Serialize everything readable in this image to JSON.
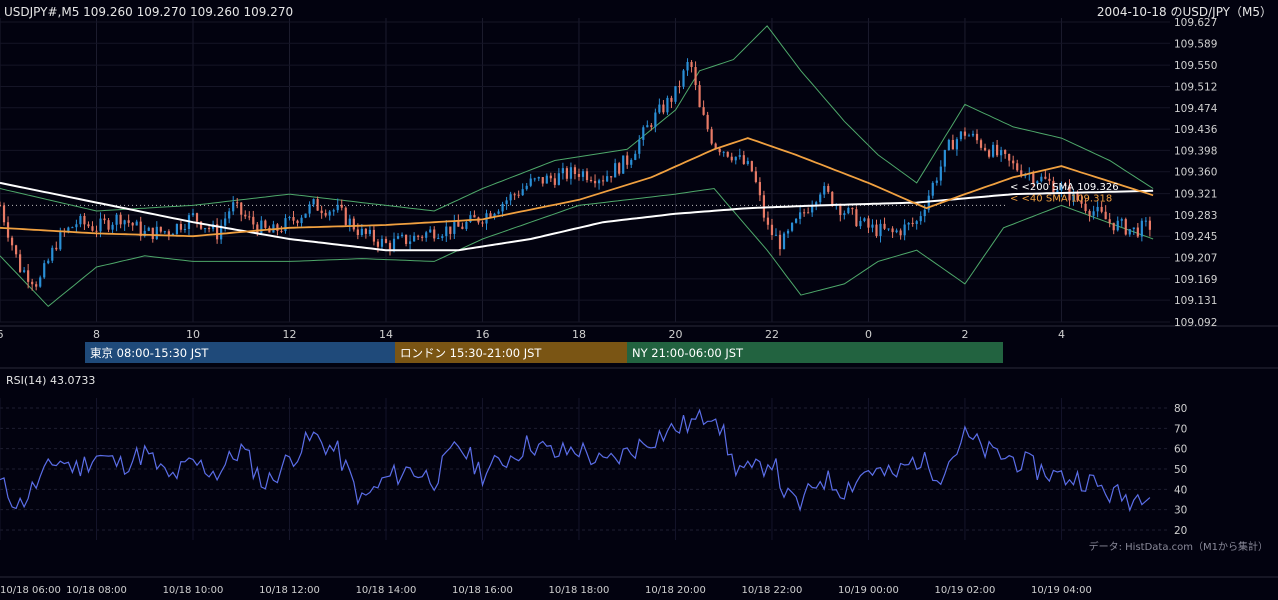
{
  "header": {
    "symbol_line": "USDJPY#,M5 109.260 109.270 109.260 109.270",
    "date_title": "2004-10-18 のUSD/JPY（M5）"
  },
  "sessions": [
    {
      "label": "東京 08:00-15:30 JST",
      "color": "#1f4a7a"
    },
    {
      "label": "ロンドン 15:30-21:00 JST",
      "color": "#7a5514"
    },
    {
      "label": "NY 21:00-06:00 JST",
      "color": "#226340"
    }
  ],
  "rsi_panel": {
    "label": "RSI(14) 43.0733",
    "source_note": "データ: HistData.com（M1から集計）"
  },
  "chart_data": [
    {
      "type": "candlestick",
      "title": "USDJPY#,M5",
      "y_ticks": [
        "109.627",
        "109.589",
        "109.550",
        "109.512",
        "109.474",
        "109.436",
        "109.398",
        "109.360",
        "109.321",
        "109.283",
        "109.245",
        "109.207",
        "109.169",
        "109.131",
        "109.092"
      ],
      "ylim": [
        109.092,
        109.627
      ],
      "x_ticks": [
        "6",
        "8",
        "10",
        "12",
        "14",
        "16",
        "18",
        "20",
        "22",
        "0",
        "2",
        "4"
      ],
      "x_hours_range": [
        6,
        29.9
      ],
      "x_tick_hours": [
        6,
        8,
        10,
        12,
        14,
        16,
        18,
        20,
        22,
        24,
        26,
        28
      ],
      "bottom_time_labels": [
        "10/18 06:00",
        "10/18 08:00",
        "10/18 10:00",
        "10/18 12:00",
        "10/18 14:00",
        "10/18 16:00",
        "10/18 18:00",
        "10/18 20:00",
        "10/18 22:00",
        "10/19 00:00",
        "10/19 02:00",
        "10/19 04:00"
      ],
      "up_color": "#2a8fd6",
      "down_color": "#e87a66",
      "price_path": [
        [
          6.0,
          109.3
        ],
        [
          6.4,
          109.19
        ],
        [
          6.8,
          109.16
        ],
        [
          7.2,
          109.24
        ],
        [
          7.6,
          109.27
        ],
        [
          8.0,
          109.26
        ],
        [
          8.5,
          109.28
        ],
        [
          9.0,
          109.25
        ],
        [
          9.5,
          109.255
        ],
        [
          10.0,
          109.28
        ],
        [
          10.5,
          109.25
        ],
        [
          10.8,
          109.3
        ],
        [
          11.2,
          109.27
        ],
        [
          11.6,
          109.25
        ],
        [
          12.0,
          109.27
        ],
        [
          12.5,
          109.3
        ],
        [
          13.0,
          109.29
        ],
        [
          13.5,
          109.25
        ],
        [
          14.0,
          109.23
        ],
        [
          14.5,
          109.24
        ],
        [
          15.0,
          109.255
        ],
        [
          15.5,
          109.26
        ],
        [
          16.0,
          109.28
        ],
        [
          16.5,
          109.31
        ],
        [
          17.0,
          109.34
        ],
        [
          17.5,
          109.35
        ],
        [
          18.0,
          109.36
        ],
        [
          18.5,
          109.35
        ],
        [
          19.0,
          109.38
        ],
        [
          19.5,
          109.45
        ],
        [
          20.0,
          109.5
        ],
        [
          20.3,
          109.56
        ],
        [
          20.5,
          109.47
        ],
        [
          20.8,
          109.41
        ],
        [
          21.2,
          109.39
        ],
        [
          21.6,
          109.36
        ],
        [
          21.9,
          109.26
        ],
        [
          22.2,
          109.23
        ],
        [
          22.6,
          109.28
        ],
        [
          23.0,
          109.33
        ],
        [
          23.5,
          109.29
        ],
        [
          24.0,
          109.26
        ],
        [
          24.5,
          109.25
        ],
        [
          25.0,
          109.27
        ],
        [
          25.3,
          109.33
        ],
        [
          25.7,
          109.41
        ],
        [
          26.0,
          109.43
        ],
        [
          26.5,
          109.4
        ],
        [
          27.0,
          109.37
        ],
        [
          27.5,
          109.35
        ],
        [
          28.0,
          109.33
        ],
        [
          28.5,
          109.3
        ],
        [
          29.0,
          109.27
        ],
        [
          29.5,
          109.255
        ],
        [
          29.9,
          109.265
        ]
      ],
      "overlays": [
        {
          "name": "<200 SMA 109.326",
          "color": "#ffffff",
          "path": [
            [
              6,
              109.34
            ],
            [
              8,
              109.305
            ],
            [
              10,
              109.27
            ],
            [
              12,
              109.24
            ],
            [
              14,
              109.22
            ],
            [
              15.5,
              109.22
            ],
            [
              17,
              109.24
            ],
            [
              18.5,
              109.27
            ],
            [
              20,
              109.285
            ],
            [
              21.5,
              109.295
            ],
            [
              23,
              109.3
            ],
            [
              25,
              109.305
            ],
            [
              27,
              109.32
            ],
            [
              29.9,
              109.326
            ]
          ]
        },
        {
          "name": "<40 SMA 109.318",
          "color": "#f0a040",
          "path": [
            [
              6,
              109.26
            ],
            [
              8,
              109.25
            ],
            [
              10,
              109.245
            ],
            [
              12,
              109.26
            ],
            [
              14,
              109.265
            ],
            [
              16,
              109.275
            ],
            [
              18,
              109.31
            ],
            [
              19.5,
              109.35
            ],
            [
              20.8,
              109.4
            ],
            [
              21.5,
              109.42
            ],
            [
              22.5,
              109.39
            ],
            [
              24,
              109.34
            ],
            [
              25.2,
              109.295
            ],
            [
              26,
              109.32
            ],
            [
              27,
              109.35
            ],
            [
              28,
              109.37
            ],
            [
              29.9,
              109.318
            ]
          ]
        },
        {
          "name": "Bollinger upper",
          "color": "#4ea86a",
          "path": [
            [
              6,
              109.33
            ],
            [
              7,
              109.31
            ],
            [
              8,
              109.29
            ],
            [
              10,
              109.3
            ],
            [
              11,
              109.31
            ],
            [
              12,
              109.32
            ],
            [
              13.5,
              109.305
            ],
            [
              15,
              109.29
            ],
            [
              16,
              109.33
            ],
            [
              17.5,
              109.38
            ],
            [
              19,
              109.4
            ],
            [
              20,
              109.47
            ],
            [
              20.5,
              109.54
            ],
            [
              21.2,
              109.56
            ],
            [
              21.9,
              109.62
            ],
            [
              22.6,
              109.54
            ],
            [
              23.5,
              109.45
            ],
            [
              24.2,
              109.39
            ],
            [
              25,
              109.34
            ],
            [
              26,
              109.48
            ],
            [
              27,
              109.44
            ],
            [
              28,
              109.42
            ],
            [
              29,
              109.38
            ],
            [
              29.9,
              109.33
            ]
          ]
        },
        {
          "name": "Bollinger lower",
          "color": "#4ea86a",
          "path": [
            [
              6,
              109.21
            ],
            [
              7,
              109.12
            ],
            [
              8,
              109.19
            ],
            [
              9,
              109.21
            ],
            [
              10,
              109.2
            ],
            [
              11,
              109.2
            ],
            [
              12,
              109.2
            ],
            [
              13.5,
              109.205
            ],
            [
              15,
              109.2
            ],
            [
              16,
              109.24
            ],
            [
              18,
              109.3
            ],
            [
              19,
              109.31
            ],
            [
              20,
              109.32
            ],
            [
              20.8,
              109.33
            ],
            [
              21.9,
              109.22
            ],
            [
              22.6,
              109.14
            ],
            [
              23.5,
              109.16
            ],
            [
              24.2,
              109.2
            ],
            [
              25,
              109.22
            ],
            [
              26,
              109.16
            ],
            [
              26.8,
              109.26
            ],
            [
              28,
              109.3
            ],
            [
              29.9,
              109.24
            ]
          ]
        }
      ],
      "reference_line": 109.3
    },
    {
      "type": "line",
      "title": "RSI(14) 43.0733",
      "y_ticks": [
        "80",
        "70",
        "60",
        "50",
        "40",
        "30",
        "20"
      ],
      "ylim": [
        15,
        85
      ],
      "series": [
        {
          "name": "RSI(14)",
          "color": "#5b6ee8",
          "x": [
            6.0,
            6.4,
            6.8,
            7.2,
            7.6,
            8.0,
            8.5,
            9.0,
            9.5,
            10.0,
            10.5,
            11.0,
            11.5,
            12.0,
            12.5,
            13.0,
            13.5,
            14.0,
            14.5,
            15.0,
            15.5,
            16.0,
            16.5,
            17.0,
            17.5,
            18.0,
            18.5,
            19.0,
            19.5,
            20.0,
            20.5,
            20.8,
            21.2,
            21.6,
            22.0,
            22.3,
            22.6,
            23.0,
            23.5,
            24.0,
            24.5,
            25.0,
            25.5,
            26.0,
            26.5,
            27.0,
            27.5,
            28.0,
            28.5,
            29.0,
            29.5,
            29.9
          ],
          "values": [
            43,
            32,
            44,
            55,
            50,
            57,
            52,
            58,
            45,
            53,
            48,
            60,
            42,
            55,
            66,
            58,
            34,
            45,
            50,
            45,
            62,
            48,
            55,
            63,
            57,
            60,
            52,
            58,
            65,
            70,
            74,
            80,
            52,
            48,
            55,
            36,
            32,
            46,
            40,
            50,
            46,
            55,
            48,
            66,
            58,
            55,
            50,
            46,
            45,
            38,
            35,
            43
          ]
        }
      ]
    }
  ]
}
